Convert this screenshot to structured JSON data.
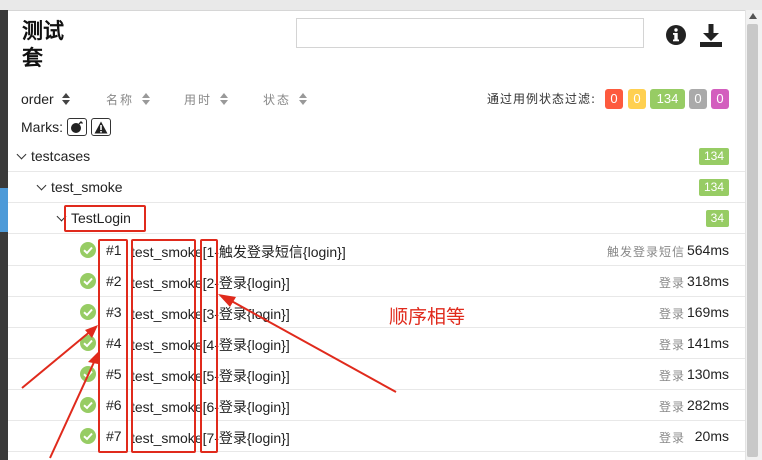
{
  "header": {
    "title": "测试套",
    "search": {
      "value": "",
      "placeholder": ""
    },
    "icons": [
      "info-icon",
      "download-icon"
    ]
  },
  "sort": {
    "fields": [
      {
        "label": "order",
        "active": true
      },
      {
        "label": "名称",
        "active": false
      },
      {
        "label": "用时",
        "active": false
      },
      {
        "label": "状态",
        "active": false
      }
    ]
  },
  "filter": {
    "label": "通过用例状态过滤:",
    "badges": [
      {
        "value": "0",
        "color": "#fd5a3e"
      },
      {
        "value": "0",
        "color": "#ffd050"
      },
      {
        "value": "134",
        "color": "#97cc64"
      },
      {
        "value": "0",
        "color": "#aaaaaa"
      },
      {
        "value": "0",
        "color": "#d35ebe"
      }
    ]
  },
  "marks": {
    "label": "Marks:",
    "icons": [
      "bomb-icon",
      "warning-icon"
    ]
  },
  "tree": [
    {
      "name": "testcases",
      "count": "134"
    },
    {
      "name": "test_smoke",
      "count": "134"
    },
    {
      "name": "TestLogin",
      "count": "34"
    }
  ],
  "cases": [
    {
      "num": "#1",
      "name": "test_smoke[1-触发登录短信{login}]",
      "desc": "触发登录短信",
      "duration": "564ms"
    },
    {
      "num": "#2",
      "name": "test_smoke[2-登录{login}]",
      "desc": "登录",
      "duration": "318ms"
    },
    {
      "num": "#3",
      "name": "test_smoke[3-登录{login}]",
      "desc": "登录",
      "duration": "169ms"
    },
    {
      "num": "#4",
      "name": "test_smoke[4-登录{login}]",
      "desc": "登录",
      "duration": "141ms"
    },
    {
      "num": "#5",
      "name": "test_smoke[5-登录{login}]",
      "desc": "登录",
      "duration": "130ms"
    },
    {
      "num": "#6",
      "name": "test_smoke[6-登录{login}]",
      "desc": "登录",
      "duration": "282ms"
    },
    {
      "num": "#7",
      "name": "test_smoke[7-登录{login}]",
      "desc": "登录",
      "duration": "20ms"
    }
  ],
  "annotation": {
    "text": "顺序相等",
    "color": "#e02a1c"
  },
  "colors": {
    "passed": "#97cc64",
    "accent": "#4d9ad8"
  }
}
